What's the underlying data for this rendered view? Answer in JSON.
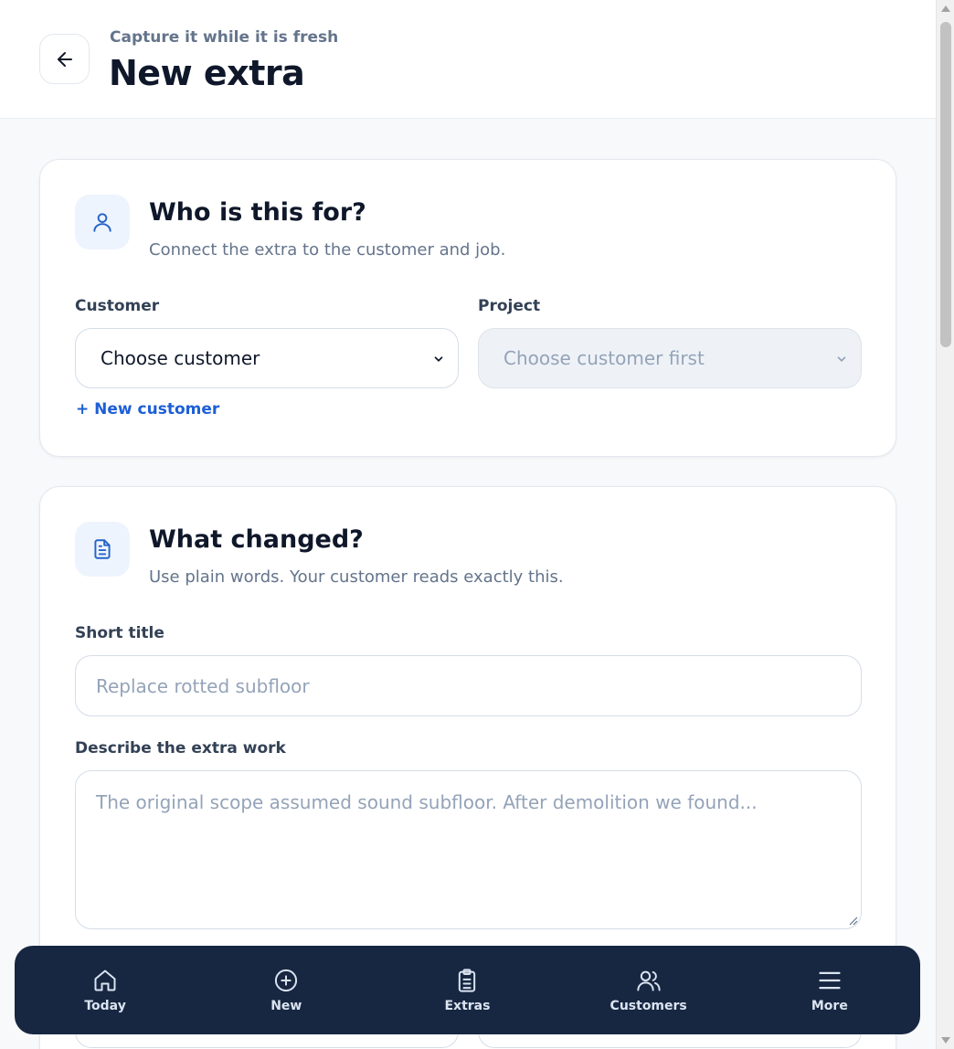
{
  "header": {
    "eyebrow": "Capture it while it is fresh",
    "title": "New extra",
    "back_icon": "arrow-left-icon"
  },
  "who_section": {
    "icon": "user-icon",
    "title": "Who is this for?",
    "subtitle": "Connect the extra to the customer and job.",
    "customer_label": "Customer",
    "customer_value": "Choose customer",
    "project_label": "Project",
    "project_value": "Choose customer first",
    "project_disabled": true,
    "new_customer_link": "+ New customer"
  },
  "what_section": {
    "icon": "document-icon",
    "title": "What changed?",
    "subtitle": "Use plain words. Your customer reads exactly this.",
    "short_title_label": "Short title",
    "short_title_placeholder": "Replace rotted subfloor",
    "short_title_value": "",
    "description_label": "Describe the extra work",
    "description_placeholder": "The original scope assumed sound subfloor. After demolition we found...",
    "description_value": ""
  },
  "bottom_nav": {
    "items": [
      {
        "label": "Today",
        "icon": "home-icon"
      },
      {
        "label": "New",
        "icon": "plus-circle-icon"
      },
      {
        "label": "Extras",
        "icon": "clipboard-list-icon"
      },
      {
        "label": "Customers",
        "icon": "users-icon"
      },
      {
        "label": "More",
        "icon": "menu-icon"
      }
    ]
  },
  "colors": {
    "accent": "#1d5fd6",
    "nav_bg": "#172742",
    "page_bg": "#f7f9fb",
    "heading": "#0f172a",
    "muted": "#64748b"
  }
}
